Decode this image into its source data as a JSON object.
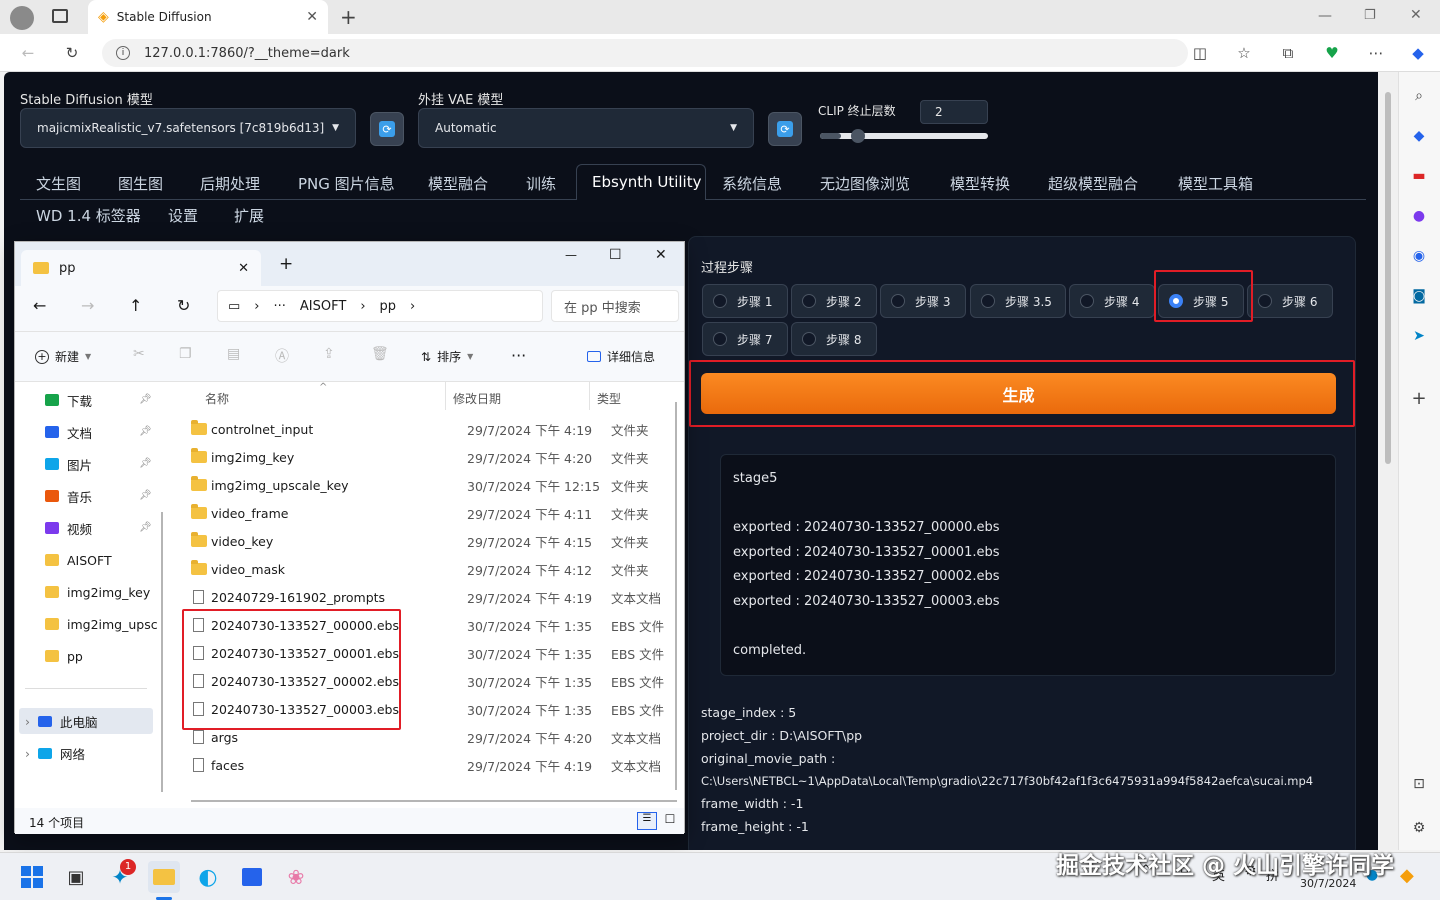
{
  "browser": {
    "tab_title": "Stable Diffusion",
    "url": "127.0.0.1:7860/?__theme=dark"
  },
  "sd": {
    "model_label": "Stable Diffusion 模型",
    "model_value": "majicmixRealistic_v7.safetensors [7c819b6d13]",
    "vae_label": "外挂 VAE 模型",
    "vae_value": "Automatic",
    "clip_label": "CLIP 终止层数",
    "clip_value": "2",
    "clip_slider_fraction": 0.125,
    "tabs_row1": [
      "文生图",
      "图生图",
      "后期处理",
      "PNG 图片信息",
      "模型融合",
      "训练",
      "Ebsynth Utility",
      "系统信息",
      "无边图像浏览",
      "模型转换",
      "超级模型融合",
      "模型工具箱"
    ],
    "tabs_row2": [
      "WD 1.4 标签器",
      "设置",
      "扩展"
    ],
    "active_tab": "Ebsynth Utility",
    "steps_label": "过程步骤",
    "steps": [
      "步骤 1",
      "步骤 2",
      "步骤 3",
      "步骤 3.5",
      "步骤 4",
      "步骤 5",
      "步骤 6",
      "步骤 7",
      "步骤 8"
    ],
    "selected_step": "步骤 5",
    "generate_label": "生成",
    "log_lines": [
      "stage5",
      "",
      "exported : 20240730-133527_00000.ebs",
      "exported : 20240730-133527_00001.ebs",
      "exported : 20240730-133527_00002.ebs",
      "exported : 20240730-133527_00003.ebs",
      "",
      "completed."
    ],
    "info_lines": [
      "stage_index : 5",
      "project_dir : D:\\AISOFT\\pp",
      "original_movie_path :",
      "C:\\Users\\NETBCL~1\\AppData\\Local\\Temp\\gradio\\22c717f30bf42af1f3c6475931a994f5842aefca\\sucai.mp4",
      "frame_width : -1",
      "frame_height : -1"
    ]
  },
  "explorer": {
    "title": "pp",
    "breadcrumb": [
      "AISOFT",
      "pp"
    ],
    "search_placeholder": "在 pp 中搜索",
    "new_label": "新建",
    "sort_label": "排序",
    "details_label": "详细信息",
    "col_name": "名称",
    "col_date": "修改日期",
    "col_type": "类型",
    "sidebar": [
      {
        "label": "下载",
        "icon": "download-icon",
        "pinned": true
      },
      {
        "label": "文档",
        "icon": "document-icon",
        "pinned": true
      },
      {
        "label": "图片",
        "icon": "pictures-icon",
        "pinned": true
      },
      {
        "label": "音乐",
        "icon": "music-icon",
        "pinned": true
      },
      {
        "label": "视频",
        "icon": "video-icon",
        "pinned": true
      },
      {
        "label": "AISOFT",
        "icon": "folder-icon",
        "pinned": false
      },
      {
        "label": "img2img_key",
        "icon": "folder-icon",
        "pinned": false
      },
      {
        "label": "img2img_upsc",
        "icon": "folder-icon",
        "pinned": false
      },
      {
        "label": "pp",
        "icon": "folder-icon",
        "pinned": false
      }
    ],
    "this_pc": "此电脑",
    "network": "网络",
    "files": [
      {
        "name": "controlnet_input",
        "date": "29/7/2024 下午 4:19",
        "type": "文件夹",
        "kind": "folder"
      },
      {
        "name": "img2img_key",
        "date": "29/7/2024 下午 4:20",
        "type": "文件夹",
        "kind": "folder"
      },
      {
        "name": "img2img_upscale_key",
        "date": "30/7/2024 下午 12:15",
        "type": "文件夹",
        "kind": "folder"
      },
      {
        "name": "video_frame",
        "date": "29/7/2024 下午 4:11",
        "type": "文件夹",
        "kind": "folder"
      },
      {
        "name": "video_key",
        "date": "29/7/2024 下午 4:15",
        "type": "文件夹",
        "kind": "folder"
      },
      {
        "name": "video_mask",
        "date": "29/7/2024 下午 4:12",
        "type": "文件夹",
        "kind": "folder"
      },
      {
        "name": "20240729-161902_prompts",
        "date": "29/7/2024 下午 4:19",
        "type": "文本文档",
        "kind": "file"
      },
      {
        "name": "20240730-133527_00000.ebs",
        "date": "30/7/2024 下午 1:35",
        "type": "EBS 文件",
        "kind": "file"
      },
      {
        "name": "20240730-133527_00001.ebs",
        "date": "30/7/2024 下午 1:35",
        "type": "EBS 文件",
        "kind": "file"
      },
      {
        "name": "20240730-133527_00002.ebs",
        "date": "30/7/2024 下午 1:35",
        "type": "EBS 文件",
        "kind": "file"
      },
      {
        "name": "20240730-133527_00003.ebs",
        "date": "30/7/2024 下午 1:35",
        "type": "EBS 文件",
        "kind": "file"
      },
      {
        "name": "args",
        "date": "29/7/2024 下午 4:20",
        "type": "文本文档",
        "kind": "file"
      },
      {
        "name": "faces",
        "date": "29/7/2024 下午 4:19",
        "type": "文本文档",
        "kind": "file"
      }
    ],
    "status": "14 个项目"
  },
  "taskbar": {
    "badge": "1",
    "ime1": "英",
    "ime2": "拼",
    "date": "30/7/2024"
  },
  "watermark": "掘金技术社区 @ 火山引擎许同学",
  "colors": {
    "accent_orange": "#f97316",
    "highlight_red": "#e11d26",
    "page_bg": "#0b0f19"
  }
}
